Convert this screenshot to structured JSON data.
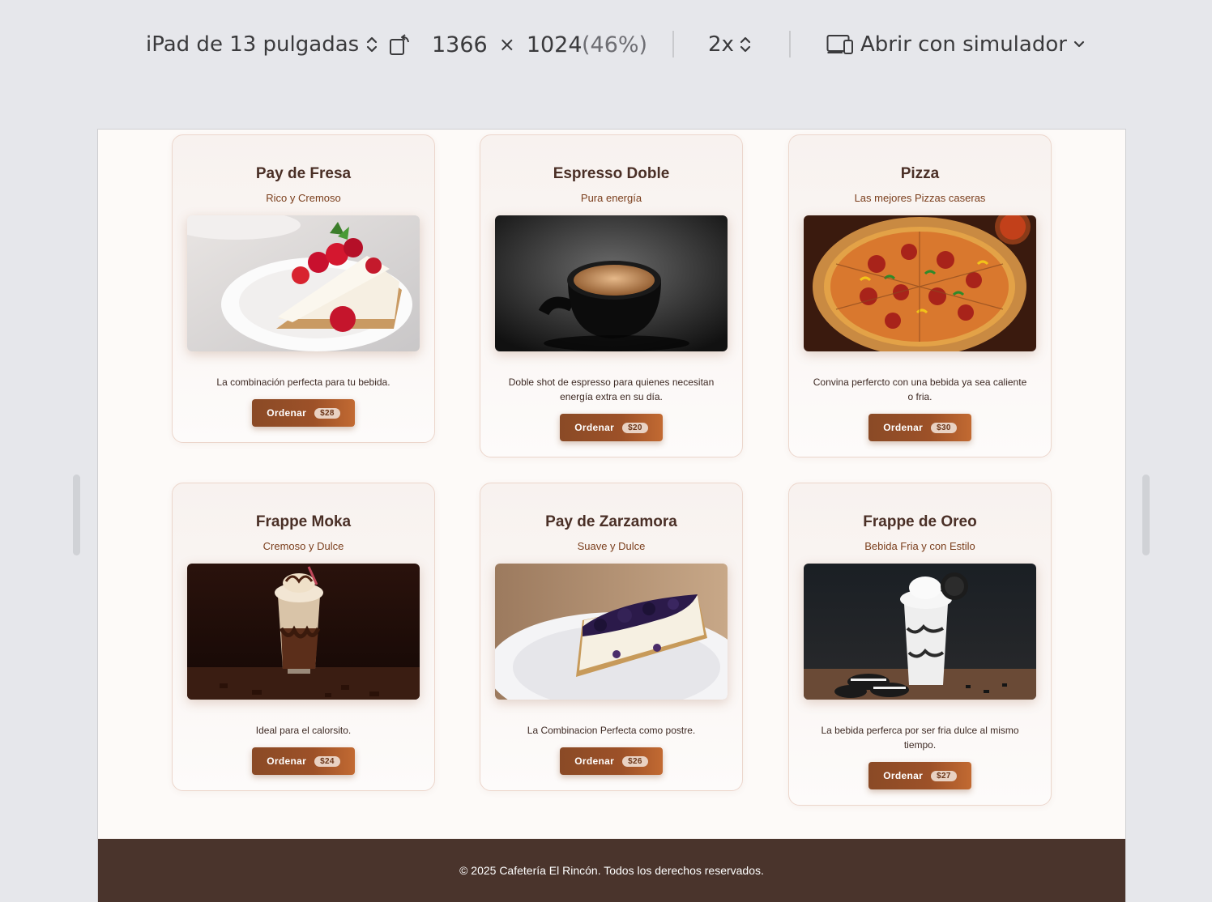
{
  "toolbar": {
    "device": "iPad de 13 pulgadas",
    "width": "1366",
    "times": "×",
    "height": "1024",
    "zoom": "(46%)",
    "scale": "2x",
    "open_with": "Abrir con simulador"
  },
  "menu": [
    {
      "title": "Pay de Fresa",
      "subtitle": "Rico y Cremoso",
      "image": "strawberry-cheesecake-photo",
      "description": "La combinación perfecta para tu bebida.",
      "button": "Ordenar",
      "price": "$28"
    },
    {
      "title": "Espresso Doble",
      "subtitle": "Pura energía",
      "image": "espresso-cup-photo",
      "description": "Doble shot de espresso para quienes necesitan energía extra en su día.",
      "button": "Ordenar",
      "price": "$20"
    },
    {
      "title": "Pizza",
      "subtitle": "Las mejores Pizzas caseras",
      "image": "pizza-photo",
      "description": "Convina perfercto con una bebida ya sea caliente o fria.",
      "button": "Ordenar",
      "price": "$30"
    },
    {
      "title": "Frappe Moka",
      "subtitle": "Cremoso y Dulce",
      "image": "mocha-frappe-photo",
      "description": "Ideal para el calorsito.",
      "button": "Ordenar",
      "price": "$24"
    },
    {
      "title": "Pay de Zarzamora",
      "subtitle": "Suave y Dulce",
      "image": "blackberry-cheesecake-photo",
      "description": "La Combinacion Perfecta como postre.",
      "button": "Ordenar",
      "price": "$26"
    },
    {
      "title": "Frappe de Oreo",
      "subtitle": "Bebida Fria y con Estilo",
      "image": "oreo-frappe-photo",
      "description": "La bebida perferca por ser fria dulce al mismo tiempo.",
      "button": "Ordenar",
      "price": "$27"
    }
  ],
  "footer": {
    "text": "© 2025 Cafetería El Rincón. Todos los derechos reservados."
  }
}
